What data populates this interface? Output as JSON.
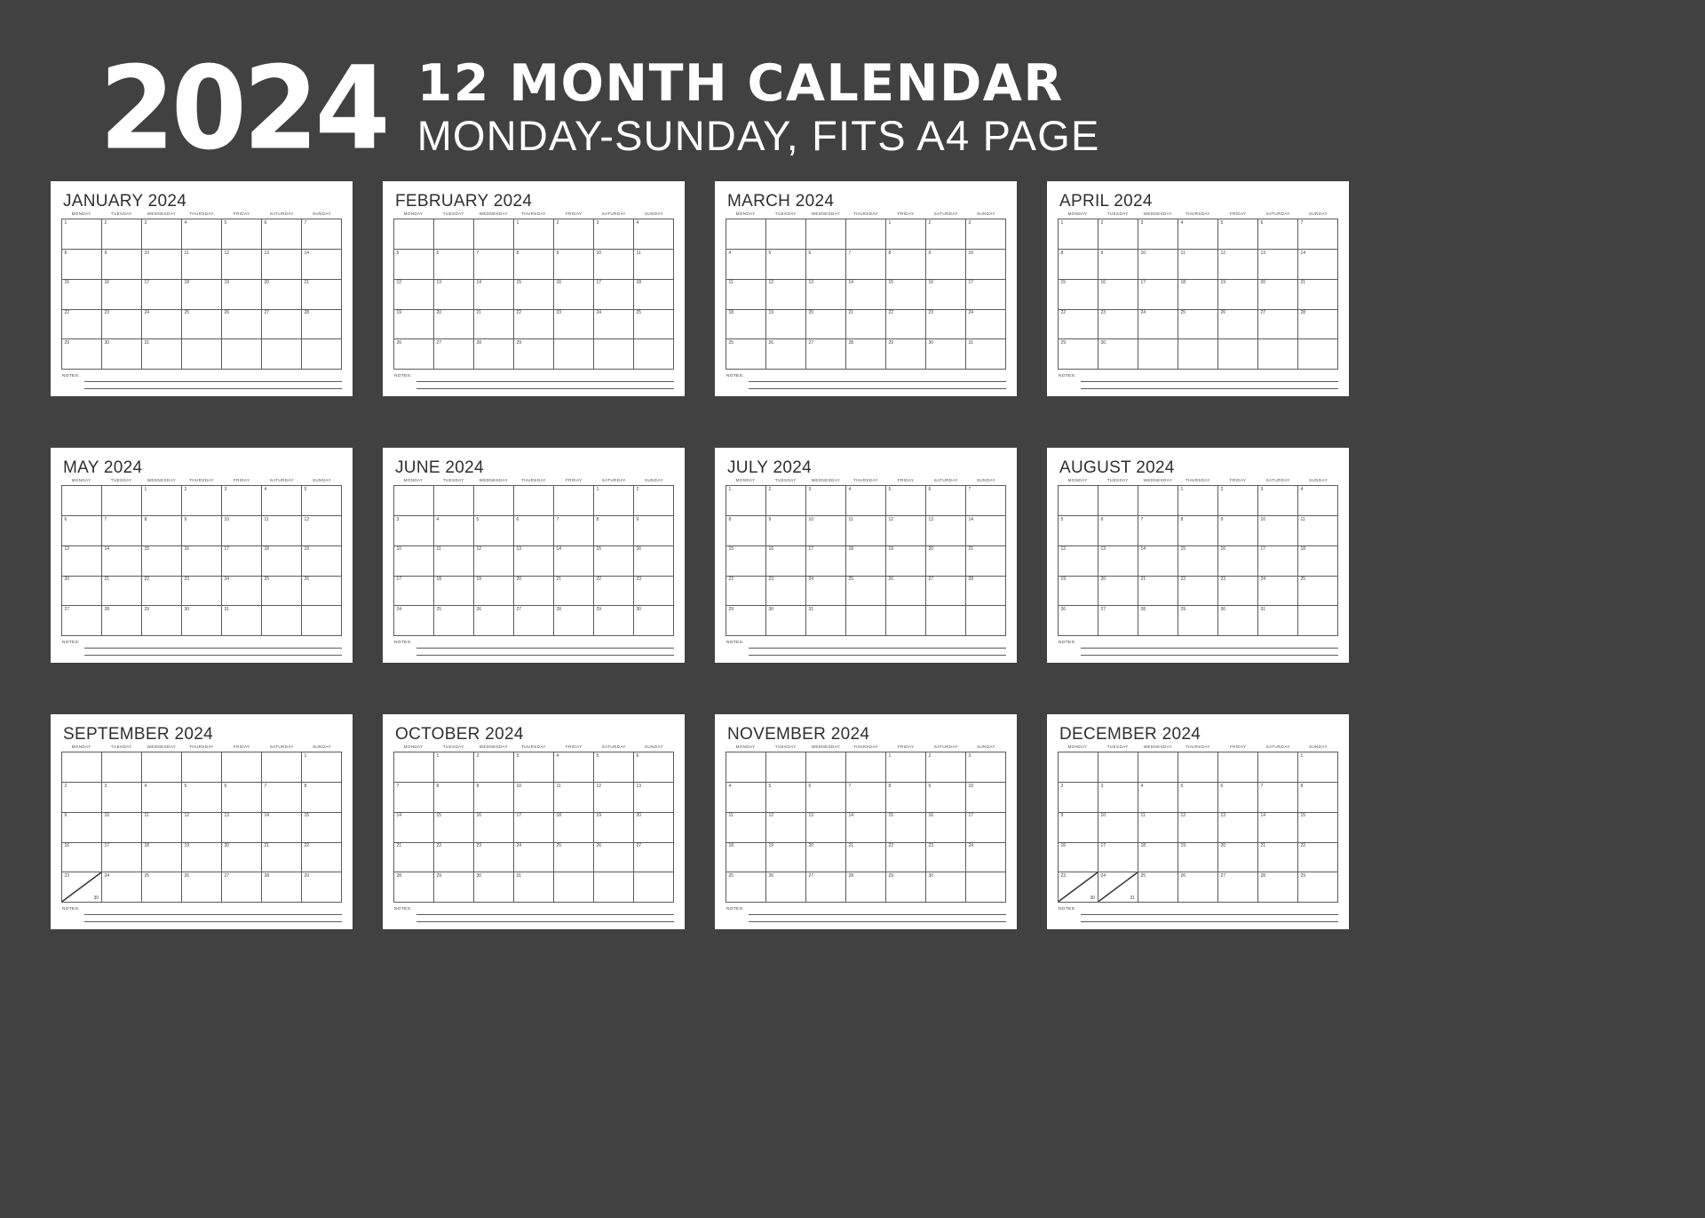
{
  "header": {
    "year": "2024",
    "title": "12 MONTH CALENDAR",
    "subtitle": "MONDAY-SUNDAY, FITS A4 PAGE"
  },
  "theme": {
    "background": "#414141",
    "card_background": "#ffffff",
    "text_color": "#2f2f2f",
    "grid_line": "#5b5b5b",
    "header_text": "#ffffff"
  },
  "weekdays": [
    "MONDAY",
    "TUESDAY",
    "WEDNESDAY",
    "THURSDAY",
    "FRIDAY",
    "SATURDAY",
    "SUNDAY"
  ],
  "notes_label": "NOTES:",
  "months": [
    {
      "title": "JANUARY 2024",
      "lead_blanks": 0,
      "days": 31,
      "rows": 5,
      "split_cells": []
    },
    {
      "title": "FEBRUARY 2024",
      "lead_blanks": 3,
      "days": 29,
      "rows": 5,
      "split_cells": []
    },
    {
      "title": "MARCH 2024",
      "lead_blanks": 4,
      "days": 31,
      "rows": 5,
      "split_cells": []
    },
    {
      "title": "APRIL 2024",
      "lead_blanks": 0,
      "days": 30,
      "rows": 5,
      "split_cells": []
    },
    {
      "title": "MAY 2024",
      "lead_blanks": 2,
      "days": 31,
      "rows": 5,
      "split_cells": []
    },
    {
      "title": "JUNE 2024",
      "lead_blanks": 5,
      "days": 30,
      "rows": 5,
      "split_cells": []
    },
    {
      "title": "JULY 2024",
      "lead_blanks": 0,
      "days": 31,
      "rows": 5,
      "split_cells": []
    },
    {
      "title": "AUGUST 2024",
      "lead_blanks": 3,
      "days": 31,
      "rows": 5,
      "split_cells": []
    },
    {
      "title": "SEPTEMBER 2024",
      "lead_blanks": 6,
      "days": 30,
      "rows": 5,
      "split_cells": [
        {
          "primary": "23",
          "secondary": "30"
        }
      ]
    },
    {
      "title": "OCTOBER 2024",
      "lead_blanks": 1,
      "days": 31,
      "rows": 5,
      "split_cells": []
    },
    {
      "title": "NOVEMBER 2024",
      "lead_blanks": 4,
      "days": 30,
      "rows": 5,
      "split_cells": []
    },
    {
      "title": "DECEMBER 2024",
      "lead_blanks": 6,
      "days": 31,
      "rows": 5,
      "split_cells": [
        {
          "primary": "23",
          "secondary": "30"
        },
        {
          "primary": "24",
          "secondary": "31"
        }
      ]
    }
  ]
}
